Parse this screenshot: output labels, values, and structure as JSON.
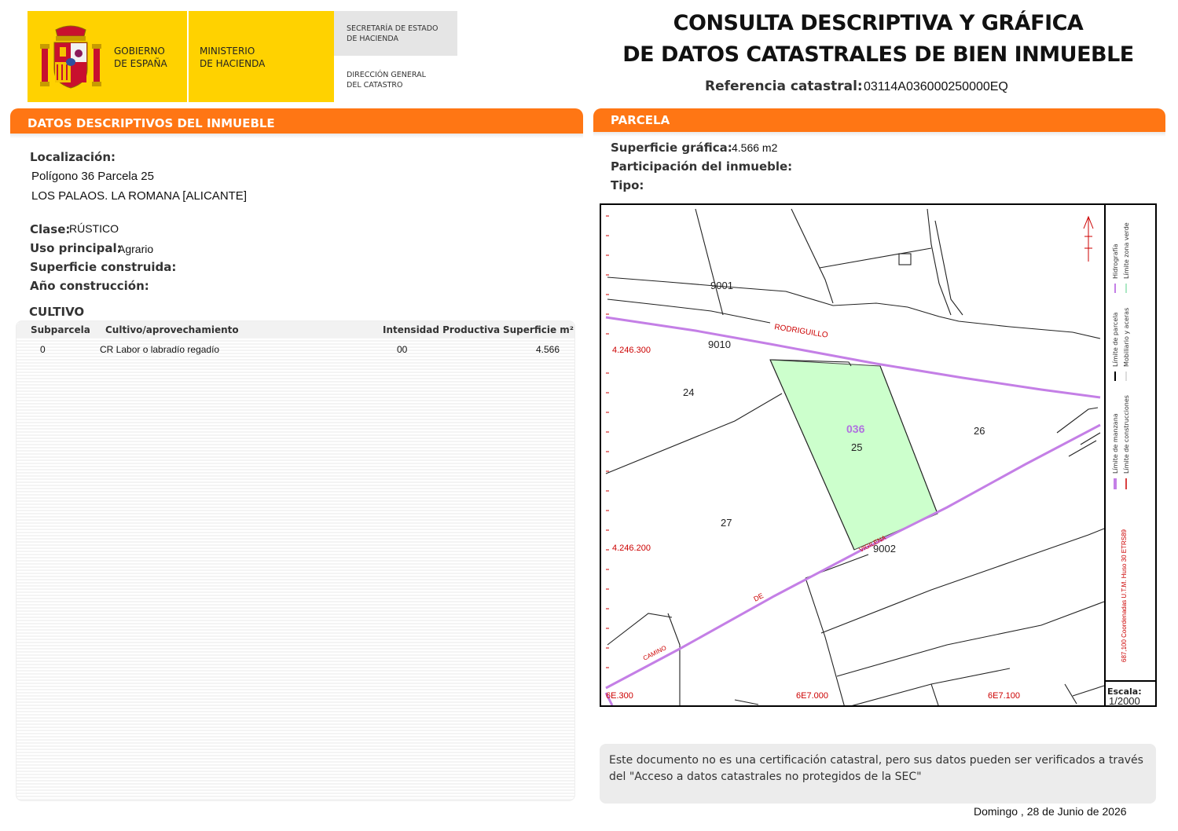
{
  "logo": {
    "gobierno_line1": "GOBIERNO",
    "gobierno_line2": "DE ESPAÑA",
    "ministerio_line1": "MINISTERIO",
    "ministerio_line2": "DE HACIENDA",
    "secretaria_line1": "SECRETARÍA DE ESTADO",
    "secretaria_line2": "DE HACIENDA",
    "direccion_line1": "DIRECCIÓN GENERAL",
    "direccion_line2": "DEL CATASTRO"
  },
  "title": {
    "line1": "CONSULTA DESCRIPTIVA Y GRÁFICA",
    "line2": "DE DATOS CATASTRALES DE BIEN INMUEBLE",
    "ref_label": "Referencia catastral:",
    "ref_value": "03114A036000250000EQ"
  },
  "left": {
    "header": "DATOS DESCRIPTIVOS DEL INMUEBLE",
    "localizacion_label": "Localización:",
    "loc_line1": "Polígono 36 Parcela 25",
    "loc_line2": "LOS PALAOS. LA ROMANA [ALICANTE]",
    "clase_label": "Clase:",
    "clase_value": "RÚSTICO",
    "uso_label": "Uso principal:",
    "uso_value": "Agrario",
    "sup_label": "Superficie construida:",
    "anio_label": "Año construcción:",
    "cultivo_title": "CULTIVO",
    "table_headers": {
      "subparcela": "Subparcela",
      "cultivo": "Cultivo/aprovechamiento",
      "intensidad": "Intensidad Productiva",
      "superficie": "Superficie m²"
    },
    "rows": [
      {
        "subparcela": "0",
        "cultivo": "CR Labor o labradío regadío",
        "intensidad": "00",
        "superficie": "4.566"
      }
    ]
  },
  "right": {
    "header": "PARCELA",
    "sup_grafica_label": "Superficie gráfica:",
    "sup_grafica_value": "4.566 m2",
    "participacion_label": "Participación del inmueble:",
    "tipo_label": "Tipo:"
  },
  "map": {
    "coord_top": "4.246.300",
    "coord_bottom": "4.246.200",
    "x_left": "6E.300",
    "x_mid": "6E7.000",
    "x_right": "6E7.100",
    "label_9001": "9001",
    "label_9010": "9010",
    "label_9002": "9002",
    "label_24": "24",
    "label_25": "25",
    "label_26": "26",
    "label_27": "27",
    "polygon_036": "036",
    "road_rodriguillo": "RODRIGUILLO",
    "road_vigilena": "VIGILENA",
    "road_de": "DE",
    "road_camino": "CAMINO",
    "escala_label": "Escala:",
    "escala_value": "1/2000",
    "legend": {
      "parcela": "Límite de parcela",
      "hidrografia": "Hidrografía",
      "manzana": "Límite de manzana",
      "zona_verde": "Límite zona verde",
      "mobiliario": "Mobiliario y aceras",
      "construcciones": "Límite de construcciones",
      "coords": "687,100 Coordenadas U.T.M. Huso 30 ETRS89"
    },
    "colors": {
      "parcel_fill": "#ccffcc",
      "road_line": "#cc88ee",
      "red_text": "#cc0000",
      "polygon_label": "#b070e0"
    }
  },
  "notice": "Este documento no es una certificación catastral, pero sus datos pueden ser verificados a través del \"Acceso a datos catastrales no protegidos de la SEC\"",
  "date": "Domingo , 28 de Junio de 2026",
  "colors": {
    "orange": "#ff7614",
    "logo_yellow": "#ffd200",
    "logo_grey": "#e5e5e5"
  }
}
